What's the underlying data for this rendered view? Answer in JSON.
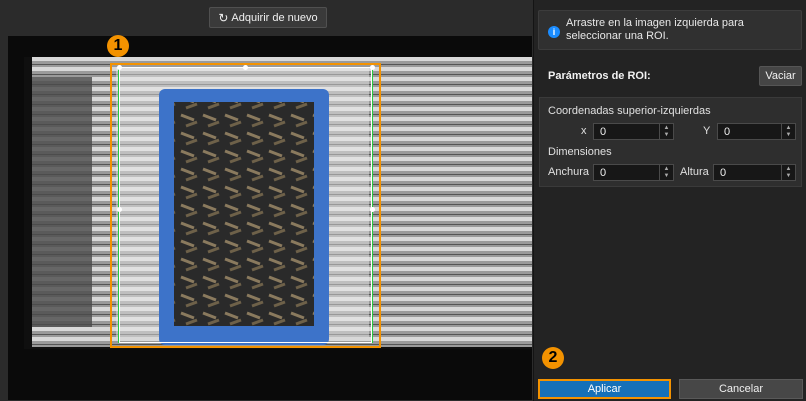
{
  "toolbar": {
    "reacquire_label": "Adquirir de nuevo",
    "reacquire_icon": "refresh-icon"
  },
  "markers": {
    "one": "1",
    "two": "2"
  },
  "info": {
    "text": "Arrastre en la imagen izquierda para seleccionar una ROI.",
    "icon": "info-icon"
  },
  "roi": {
    "title": "Parámetros de ROI:",
    "clear_label": "Vaciar",
    "top_left_label": "Coordenadas superior-izquierdas",
    "x_label": "x",
    "x_value": "0",
    "y_label": "Y",
    "y_value": "0",
    "dimensions_label": "Dimensiones",
    "width_label": "Anchura",
    "width_value": "0",
    "height_label": "Altura",
    "height_value": "0"
  },
  "actions": {
    "apply_label": "Aplicar",
    "cancel_label": "Cancelar"
  },
  "colors": {
    "accent": "#f39200",
    "primary": "#1570b8",
    "info": "#1a8cff",
    "bin_blue": "#3d73c9"
  }
}
